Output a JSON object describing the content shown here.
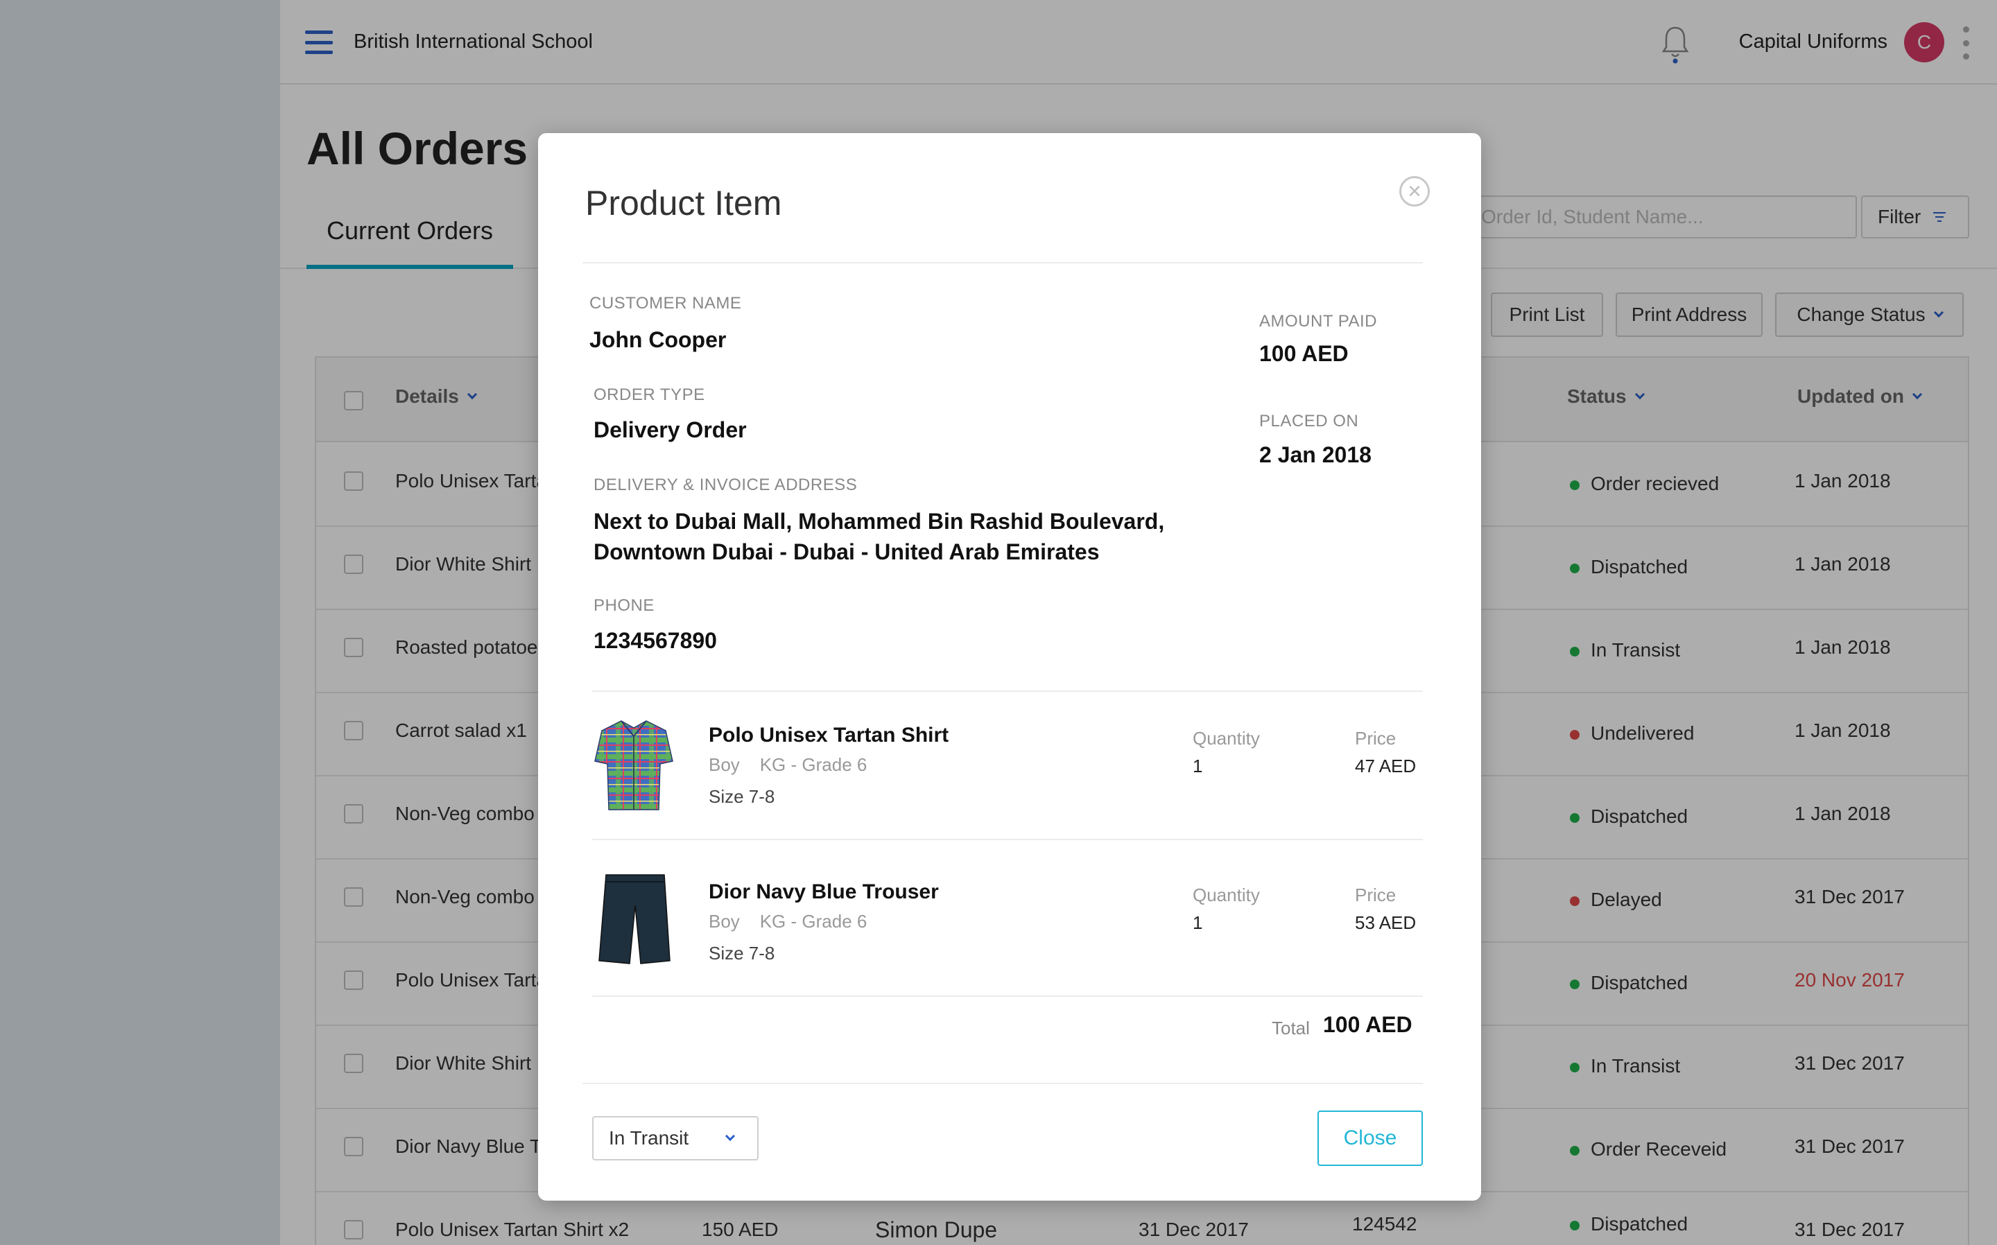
{
  "header": {
    "school_name": "British International School",
    "vendor_name": "Capital Uniforms",
    "avatar_initial": "C"
  },
  "page": {
    "title": "All Orders",
    "tab_current": "Current Orders",
    "search_placeholder": "Order Id, Student Name...",
    "filter_label": "Filter"
  },
  "actions": {
    "print_list": "Print List",
    "print_address": "Print Address",
    "change_status": "Change Status"
  },
  "table": {
    "headers": {
      "details": "Details",
      "status": "Status",
      "updated_on": "Updated on"
    },
    "rows": [
      {
        "details": "Polo Unisex Tarta",
        "status": "Order recieved",
        "status_color": "#1fb24a",
        "date": "1 Jan 2018",
        "date_color": "#333333"
      },
      {
        "details": "Dior White Shirt",
        "status": "Dispatched",
        "status_color": "#1fb24a",
        "date": "1 Jan 2018",
        "date_color": "#333333"
      },
      {
        "details": "Roasted potatoe",
        "status": "In Transist",
        "status_color": "#1fb24a",
        "date": "1 Jan 2018",
        "date_color": "#333333"
      },
      {
        "details": "Carrot salad x1",
        "status": "Undelivered",
        "status_color": "#e04848",
        "date": "1 Jan 2018",
        "date_color": "#333333"
      },
      {
        "details": "Non-Veg combo",
        "status": "Dispatched",
        "status_color": "#1fb24a",
        "date": "1 Jan 2018",
        "date_color": "#333333"
      },
      {
        "details": "Non-Veg combo",
        "status": "Delayed",
        "status_color": "#e04848",
        "date": "31 Dec 2017",
        "date_color": "#333333"
      },
      {
        "details": "Polo Unisex Tarta",
        "status": "Dispatched",
        "status_color": "#1fb24a",
        "date": "20 Nov 2017",
        "date_color": "#e04848"
      },
      {
        "details": "Dior White Shirt",
        "status": "In Transist",
        "status_color": "#1fb24a",
        "date": "31 Dec 2017",
        "date_color": "#333333"
      },
      {
        "details": "Dior Navy Blue T",
        "status": "Order Receveid",
        "status_color": "#1fb24a",
        "date": "31 Dec 2017",
        "date_color": "#333333"
      },
      {
        "details": "Polo Unisex Tartan Shirt x2",
        "status": "Dispatched",
        "status_color": "#1fb24a",
        "date": "31 Dec 2017",
        "date_color": "#333333",
        "amount": "150 AED",
        "customer": "Simon Dupe",
        "placed": "31 Dec 2017",
        "order_id": "124542"
      }
    ]
  },
  "modal": {
    "title": "Product Item",
    "customer_name_label": "CUSTOMER NAME",
    "customer_name": "John Cooper",
    "amount_paid_label": "AMOUNT PAID",
    "amount_paid": "100 AED",
    "order_type_label": "ORDER TYPE",
    "order_type": "Delivery Order",
    "placed_on_label": "PLACED ON",
    "placed_on": "2 Jan 2018",
    "address_label": "DELIVERY & INVOICE ADDRESS",
    "address_line1": "Next to Dubai Mall, Mohammed Bin Rashid Boulevard,",
    "address_line2": "Downtown Dubai - Dubai - United Arab Emirates",
    "phone_label": "PHONE",
    "phone": "1234567890",
    "items": [
      {
        "name": "Polo Unisex Tartan Shirt",
        "gender": "Boy",
        "grade": "KG - Grade 6",
        "size": "Size 7-8",
        "quantity_label": "Quantity",
        "quantity": "1",
        "price_label": "Price",
        "price": "47 AED",
        "icon": "tartan-shirt-icon"
      },
      {
        "name": "Dior Navy Blue Trouser",
        "gender": "Boy",
        "grade": "KG - Grade 6",
        "size": "Size 7-8",
        "quantity_label": "Quantity",
        "quantity": "1",
        "price_label": "Price",
        "price": "53 AED",
        "icon": "trouser-icon"
      }
    ],
    "total_label": "Total",
    "total": "100 AED",
    "status_select": "In Transit",
    "close_label": "Close"
  },
  "colors": {
    "accent": "#0aa6c4",
    "brand_blue": "#2d61c8",
    "avatar": "#d63a66",
    "status_green": "#1fb24a",
    "status_red": "#e04848"
  }
}
